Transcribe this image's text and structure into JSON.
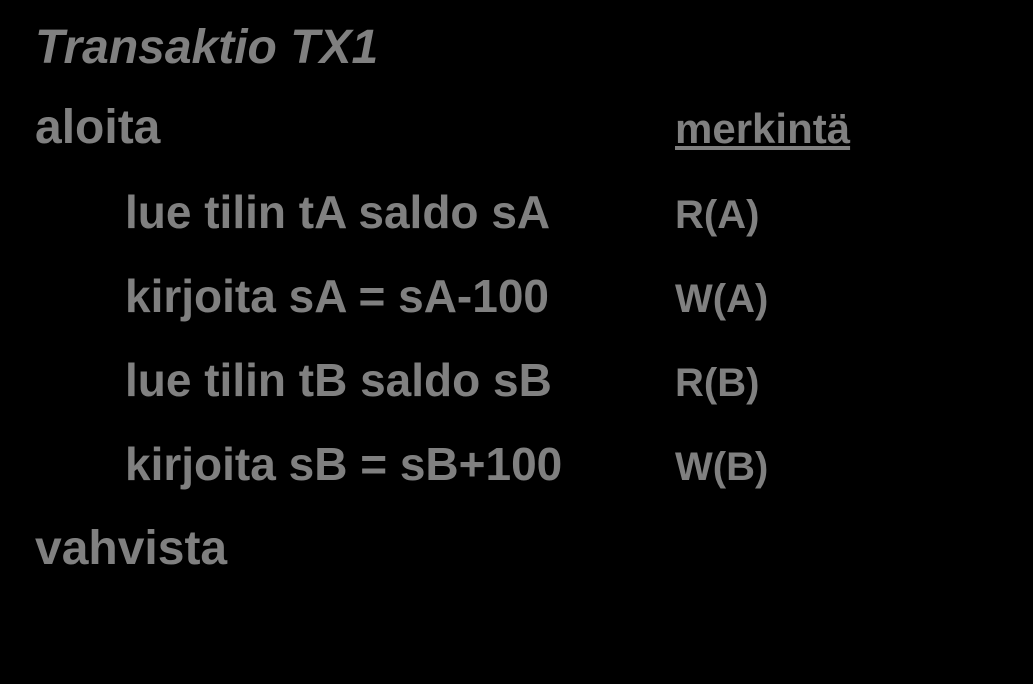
{
  "title": "Transaktio TX1",
  "begin": "aloita",
  "notation_header": "merkintä",
  "end": "vahvista",
  "steps": [
    {
      "text": "lue tilin tA saldo sA",
      "notation": "R(A)"
    },
    {
      "text": "kirjoita sA = sA-100",
      "notation": "W(A)"
    },
    {
      "text": "lue tilin tB saldo sB",
      "notation": "R(B)"
    },
    {
      "text": "kirjoita sB = sB+100",
      "notation": "W(B)"
    }
  ]
}
